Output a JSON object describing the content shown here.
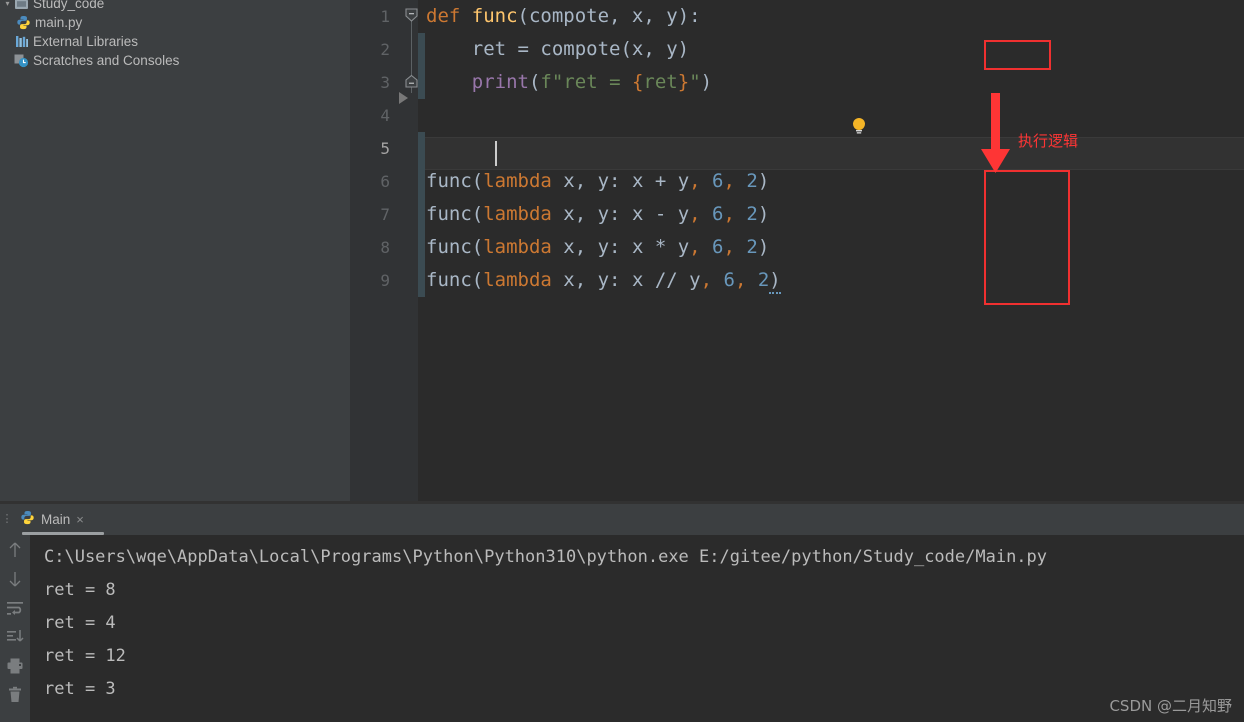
{
  "project": {
    "items": [
      {
        "label": "Study_code",
        "icon": "folder-icon",
        "arrow": "▾",
        "indent": 0,
        "selected": false
      },
      {
        "label": "main.py",
        "icon": "python-file-icon",
        "arrow": "",
        "indent": 1,
        "selected": false
      },
      {
        "label": "External Libraries",
        "icon": "library-icon",
        "arrow": "",
        "indent": 0,
        "selected": false
      },
      {
        "label": "Scratches and Consoles",
        "icon": "scratches-icon",
        "arrow": "",
        "indent": 0,
        "selected": false
      }
    ]
  },
  "editor": {
    "line_numbers": [
      "1",
      "2",
      "3",
      "4",
      "5",
      "6",
      "7",
      "8",
      "9"
    ],
    "active_line": "5",
    "lines": [
      {
        "n": "1",
        "text": "def func(compote, x, y):"
      },
      {
        "n": "2",
        "text": "    ret = compote(x, y)"
      },
      {
        "n": "3",
        "text": "    print(f\"ret = {ret}\")"
      },
      {
        "n": "4",
        "text": ""
      },
      {
        "n": "5",
        "text": ""
      },
      {
        "n": "6",
        "text": "func(lambda x, y: x + y, 6, 2)"
      },
      {
        "n": "7",
        "text": "func(lambda x, y: x - y, 6, 2)"
      },
      {
        "n": "8",
        "text": "func(lambda x, y: x * y, 6, 2)"
      },
      {
        "n": "9",
        "text": "func(lambda x, y: x // y, 6, 2)"
      }
    ],
    "tokens": {
      "kw_def": "def",
      "fn_name": "func",
      "params": "(compote, x, y):",
      "ret_assign": "ret = compote",
      "ret_args": "(x, y)",
      "print_kw": "print",
      "print_open": "(",
      "fstr_f": "f",
      "fstr_body": "\"ret = ",
      "fstr_brace_open": "{",
      "fstr_expr": "ret",
      "fstr_brace_close": "}",
      "fstr_tail": "\"",
      "print_close": ")",
      "call_fn": "func",
      "call_open": "(",
      "kw_lambda": "lambda",
      "lambda_params": " x, y: ",
      "body_add": "x + y",
      "body_sub": "x - y",
      "body_mul": "x * y",
      "body_div": "x // y",
      "comma": ",",
      "arg_six": "6",
      "arg_two": "2",
      "call_close": ")"
    }
  },
  "annotations": {
    "label": "执行逻辑",
    "color": "#fe3535",
    "boxes": [
      "highlight-box-call-args",
      "highlight-box-lambda-bodies"
    ]
  },
  "run_panel": {
    "tab": {
      "label": "Main",
      "icon": "python-run-icon",
      "close": "×"
    },
    "toolbar": [
      {
        "name": "scroll-up-icon",
        "glyph": "↑"
      },
      {
        "name": "scroll-down-icon",
        "glyph": "↓"
      },
      {
        "name": "soft-wrap-icon",
        "glyph": ""
      },
      {
        "name": "scroll-to-end-icon",
        "glyph": ""
      },
      {
        "name": "print-icon",
        "glyph": ""
      },
      {
        "name": "clear-all-icon",
        "glyph": ""
      }
    ],
    "console_lines": [
      "C:\\Users\\wqe\\AppData\\Local\\Programs\\Python\\Python310\\python.exe E:/gitee/python/Study_code/Main.py",
      "ret = 8",
      "ret = 4",
      "ret = 12",
      "ret = 3"
    ]
  },
  "watermark": {
    "text": "CSDN @二月知野"
  },
  "colors": {
    "editor_bg": "#2b2b2b",
    "panel_bg": "#3c3f41",
    "gutter_bg": "#313335",
    "keyword": "#cc7832",
    "function": "#ffc66d",
    "number": "#6897bb",
    "string": "#6a8759",
    "builtin": "#9876aa",
    "text": "#a9b7c6",
    "annotation_red": "#fe3535"
  }
}
